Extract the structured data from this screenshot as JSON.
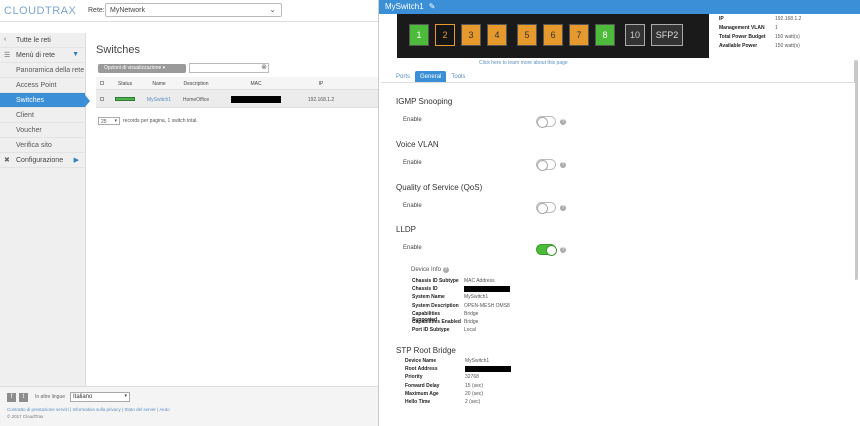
{
  "header": {
    "logo": "CLOUDTRAX",
    "network_label": "Rete:",
    "network_value": "MyNetwork"
  },
  "sidebar": {
    "items": [
      {
        "label": "Tutte le reti",
        "type": "top"
      },
      {
        "label": "Menù di rete",
        "type": "top-expand"
      },
      {
        "label": "Panoramica della rete",
        "type": "sub"
      },
      {
        "label": "Access Point",
        "type": "sub"
      },
      {
        "label": "Switches",
        "type": "sub-active"
      },
      {
        "label": "Client",
        "type": "sub"
      },
      {
        "label": "Voucher",
        "type": "sub"
      },
      {
        "label": "Verifica sito",
        "type": "sub"
      },
      {
        "label": "Configurazione",
        "type": "top-arrow"
      }
    ]
  },
  "main": {
    "title": "Switches",
    "view_options": "Opzioni di visualizzazione",
    "search_placeholder": "",
    "columns": [
      "Status",
      "Name",
      "Description",
      "MAC",
      "IP"
    ],
    "rows": [
      {
        "name": "MySwitch1",
        "description": "HomeOffice",
        "ip": "192.168.1.2"
      }
    ],
    "page_size": "25",
    "pager_text": "records per pagina, 1 switch total."
  },
  "footer": {
    "social": [
      "f",
      "t"
    ],
    "lang_label": "In altre lingue",
    "lang_value": "Italiano",
    "links": "Contratto di prestazione servizi | Informativa sulla privacy | Stato del server | Aiuto",
    "copyright": "© 2017 CloudTrax"
  },
  "panel": {
    "title": "MySwitch1",
    "ports": [
      "1",
      "2",
      "3",
      "4",
      "5",
      "6",
      "7",
      "8",
      "10",
      "SFP2"
    ],
    "learn_more": "Click here to learn more about this page",
    "info": [
      {
        "k": "IP",
        "v": "192.168.1.2"
      },
      {
        "k": "Management VLAN",
        "v": "1"
      },
      {
        "k": "Total Power Budget",
        "v": "150 watt(s)"
      },
      {
        "k": "Available Power",
        "v": "150 watt(s)"
      }
    ],
    "tabs": [
      "Ports",
      "General",
      "Tools"
    ],
    "sections": {
      "igmp": {
        "title": "IGMP Snooping",
        "enable": "Enable"
      },
      "voice": {
        "title": "Voice VLAN",
        "enable": "Enable"
      },
      "qos": {
        "title": "Quality of Service (QoS)",
        "enable": "Enable"
      },
      "lldp": {
        "title": "LLDP",
        "enable": "Enable"
      },
      "stp": {
        "title": "STP Root Bridge"
      }
    },
    "device_info": {
      "title": "Device Info",
      "rows": [
        {
          "k": "Chassis ID Subtype",
          "v": "MAC Address"
        },
        {
          "k": "Chassis ID",
          "v": ""
        },
        {
          "k": "System Name",
          "v": "MySwitch1"
        },
        {
          "k": "System Description",
          "v": "OPEN-MESH OMS8"
        },
        {
          "k": "Capabilities Supported",
          "v": "Bridge"
        },
        {
          "k": "Capabilities Enabled",
          "v": "Bridge"
        },
        {
          "k": "Port ID Subtype",
          "v": "Local"
        }
      ]
    },
    "stp_rows": [
      {
        "k": "Device Name",
        "v": "MySwitch1"
      },
      {
        "k": "Root Address",
        "v": ""
      },
      {
        "k": "Priority",
        "v": "32768"
      },
      {
        "k": "Forward Delay",
        "v": "15 (sec)"
      },
      {
        "k": "Maximum Age",
        "v": "20 (sec)"
      },
      {
        "k": "Hello Time",
        "v": "2 (sec)"
      }
    ]
  }
}
